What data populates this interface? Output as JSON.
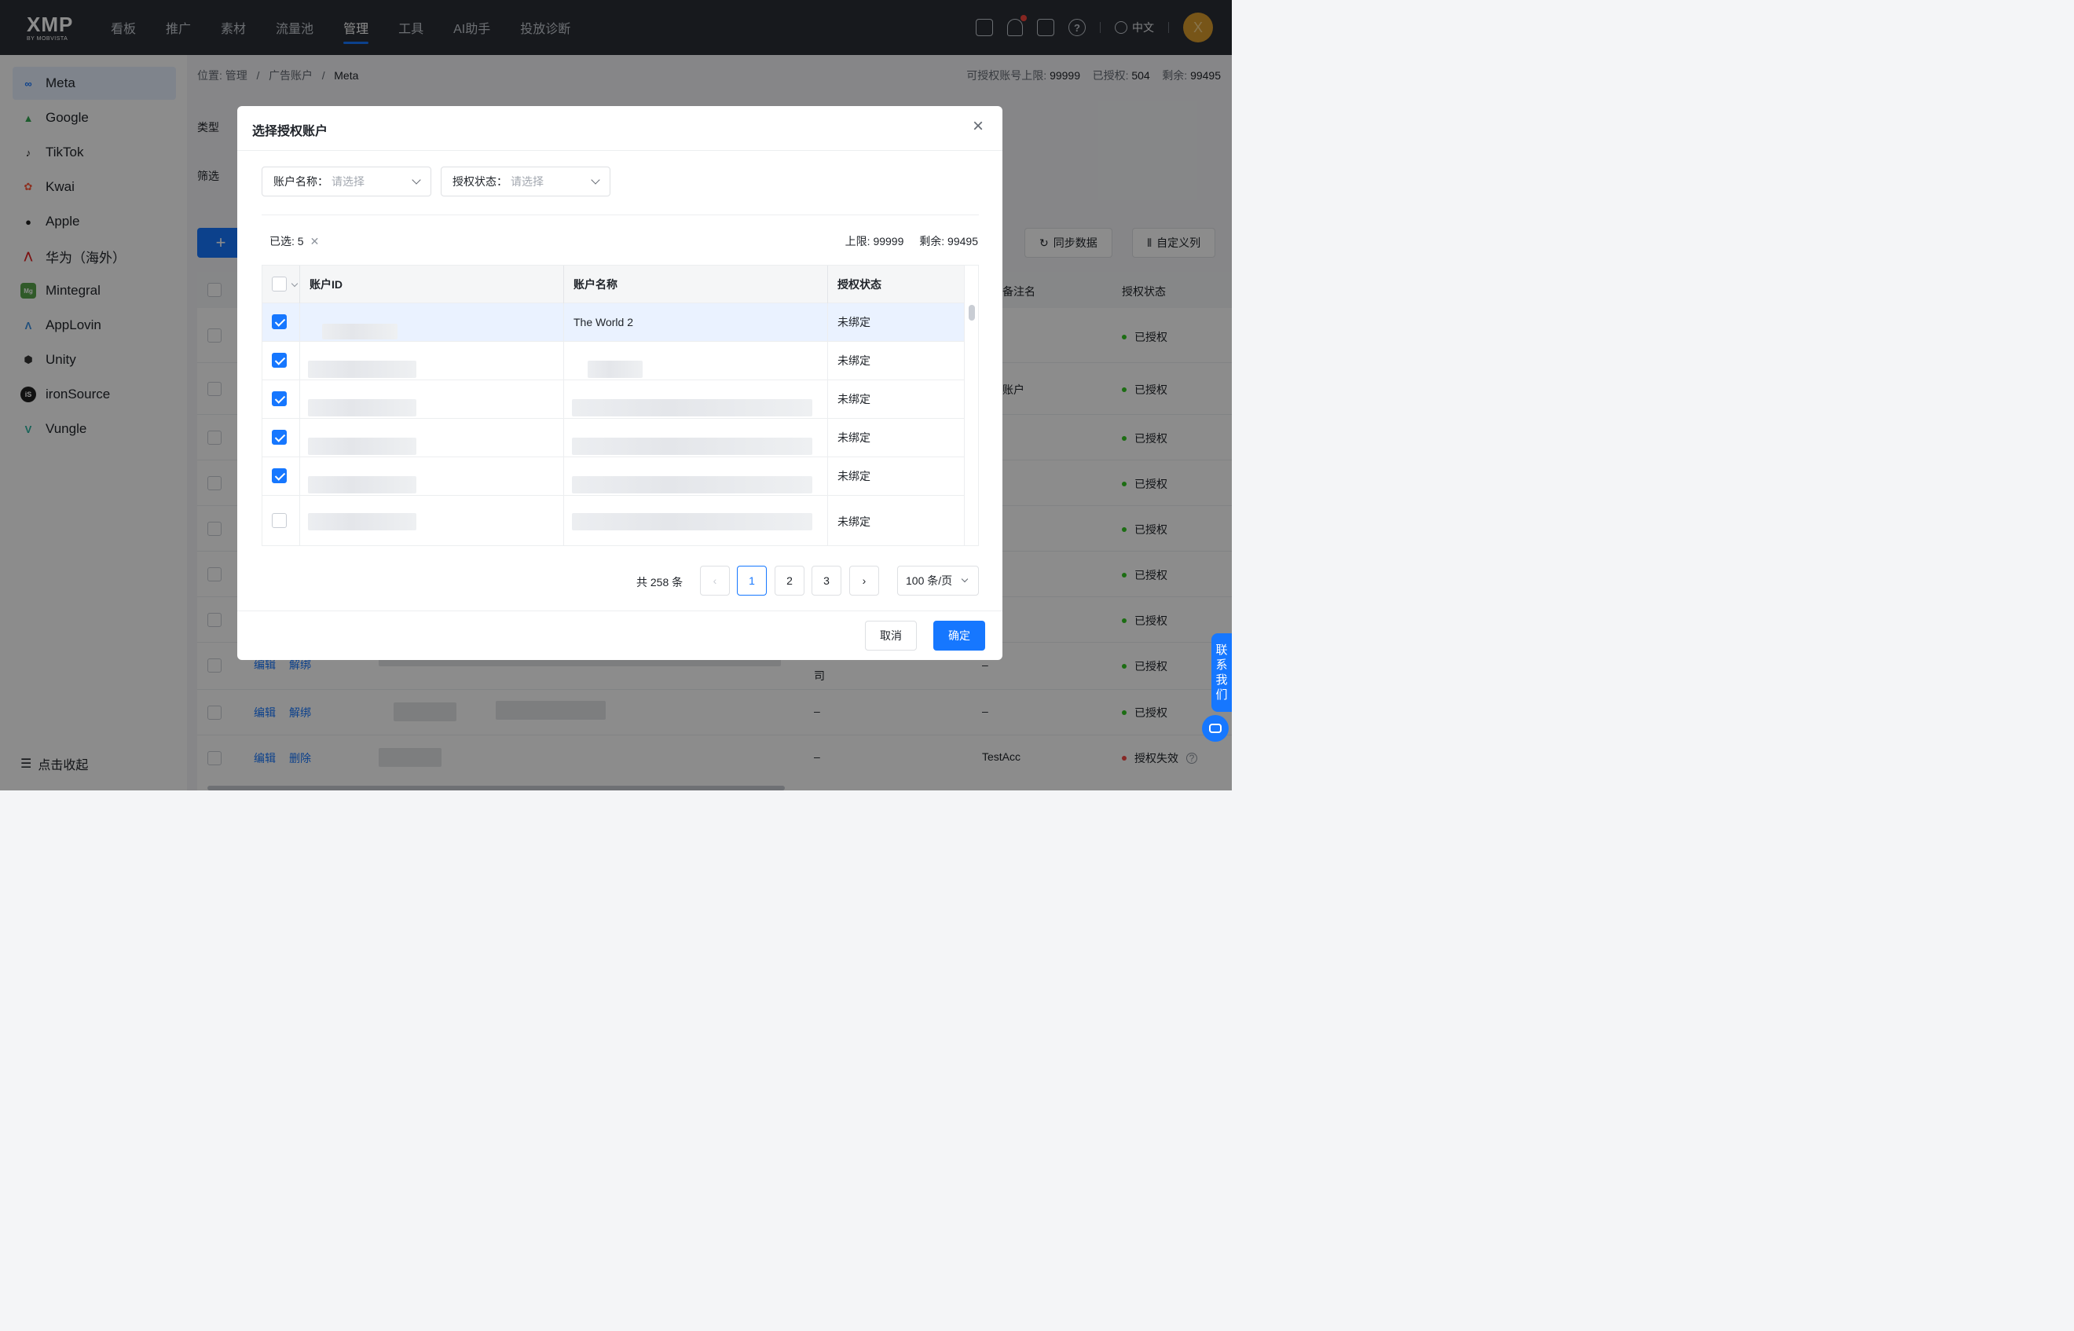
{
  "brand": {
    "logo_text": "XMP",
    "logo_sub": "BY MOBVISTA"
  },
  "nav": {
    "items": [
      "看板",
      "推广",
      "素材",
      "流量池",
      "管理",
      "工具",
      "AI助手",
      "投放诊断"
    ],
    "active": "管理"
  },
  "header": {
    "language": "中文",
    "avatar_letter": "X"
  },
  "sidebar": {
    "items": [
      {
        "label": "Meta",
        "icon": "meta-icon",
        "active": true
      },
      {
        "label": "Google",
        "icon": "google-icon"
      },
      {
        "label": "TikTok",
        "icon": "tiktok-icon"
      },
      {
        "label": "Kwai",
        "icon": "kwai-icon"
      },
      {
        "label": "Apple",
        "icon": "apple-icon"
      },
      {
        "label": "华为（海外）",
        "icon": "huawei-icon"
      },
      {
        "label": "Mintegral",
        "icon": "mintegral-icon"
      },
      {
        "label": "AppLovin",
        "icon": "applovin-icon"
      },
      {
        "label": "Unity",
        "icon": "unity-icon"
      },
      {
        "label": "ironSource",
        "icon": "ironsource-icon"
      },
      {
        "label": "Vungle",
        "icon": "vungle-icon"
      }
    ],
    "collapse_label": "点击收起"
  },
  "page": {
    "breadcrumb": {
      "prefix": "位置: 管理",
      "sep": "/",
      "level2": "广告账户",
      "current": "Meta"
    },
    "quota": {
      "limit_label": "可授权账号上限:",
      "limit": "99999",
      "authorized_label": "已授权:",
      "authorized": "504",
      "remaining_label": "剩余:",
      "remaining": "99495"
    },
    "type_label": "类型",
    "filter_label": "筛选",
    "add_label": "+",
    "sync_label": "同步数据",
    "custom_columns_label": "自定义列",
    "columns": {
      "remark": "备注名",
      "status": "授权状态"
    },
    "rows": [
      {
        "status": "已授权"
      },
      {
        "status": "已授权",
        "remark": "账户"
      },
      {
        "status": "已授权"
      },
      {
        "status": "已授权"
      },
      {
        "status": "已授权"
      },
      {
        "status": "已授权"
      },
      {
        "status": "已授权"
      },
      {
        "status": "已授权",
        "edit": "编辑",
        "unbind": "解绑",
        "name_tail": "司",
        "remark": "–"
      },
      {
        "status": "已授权",
        "edit": "编辑",
        "unbind": "解绑",
        "name_tail": "–",
        "remark": "–"
      },
      {
        "status": "授权失效",
        "edit": "编辑",
        "delete": "删除",
        "name_tail": "–",
        "remark": "TestAcc"
      }
    ]
  },
  "contact": {
    "label_chars": [
      "联",
      "系",
      "我",
      "们"
    ]
  },
  "modal": {
    "title": "选择授权账户",
    "filters": [
      {
        "label": "账户名称：",
        "placeholder": "请选择"
      },
      {
        "label": "授权状态：",
        "placeholder": "请选择"
      }
    ],
    "selected": "已选: 5",
    "limit_text": "上限: 99999",
    "remaining_text": "剩余: 99495",
    "columns": {
      "id": "账户ID",
      "name": "账户名称",
      "status": "授权状态"
    },
    "rows": [
      {
        "checked": true,
        "name": "The World 2",
        "status": "未绑定"
      },
      {
        "checked": true,
        "name": "",
        "status": "未绑定"
      },
      {
        "checked": true,
        "name": "",
        "status": "未绑定"
      },
      {
        "checked": true,
        "name": "",
        "status": "未绑定"
      },
      {
        "checked": true,
        "name": "",
        "status": "未绑定"
      },
      {
        "checked": false,
        "name": "",
        "status": "未绑定"
      }
    ],
    "pagination": {
      "total": "共 258 条",
      "pages": [
        "1",
        "2",
        "3"
      ],
      "current": "1",
      "page_size": "100 条/页"
    },
    "cancel_label": "取消",
    "ok_label": "确定"
  },
  "colors": {
    "primary": "#1677ff",
    "topbar": "#2b2f36",
    "success": "#34c724",
    "error": "#f54a45"
  }
}
